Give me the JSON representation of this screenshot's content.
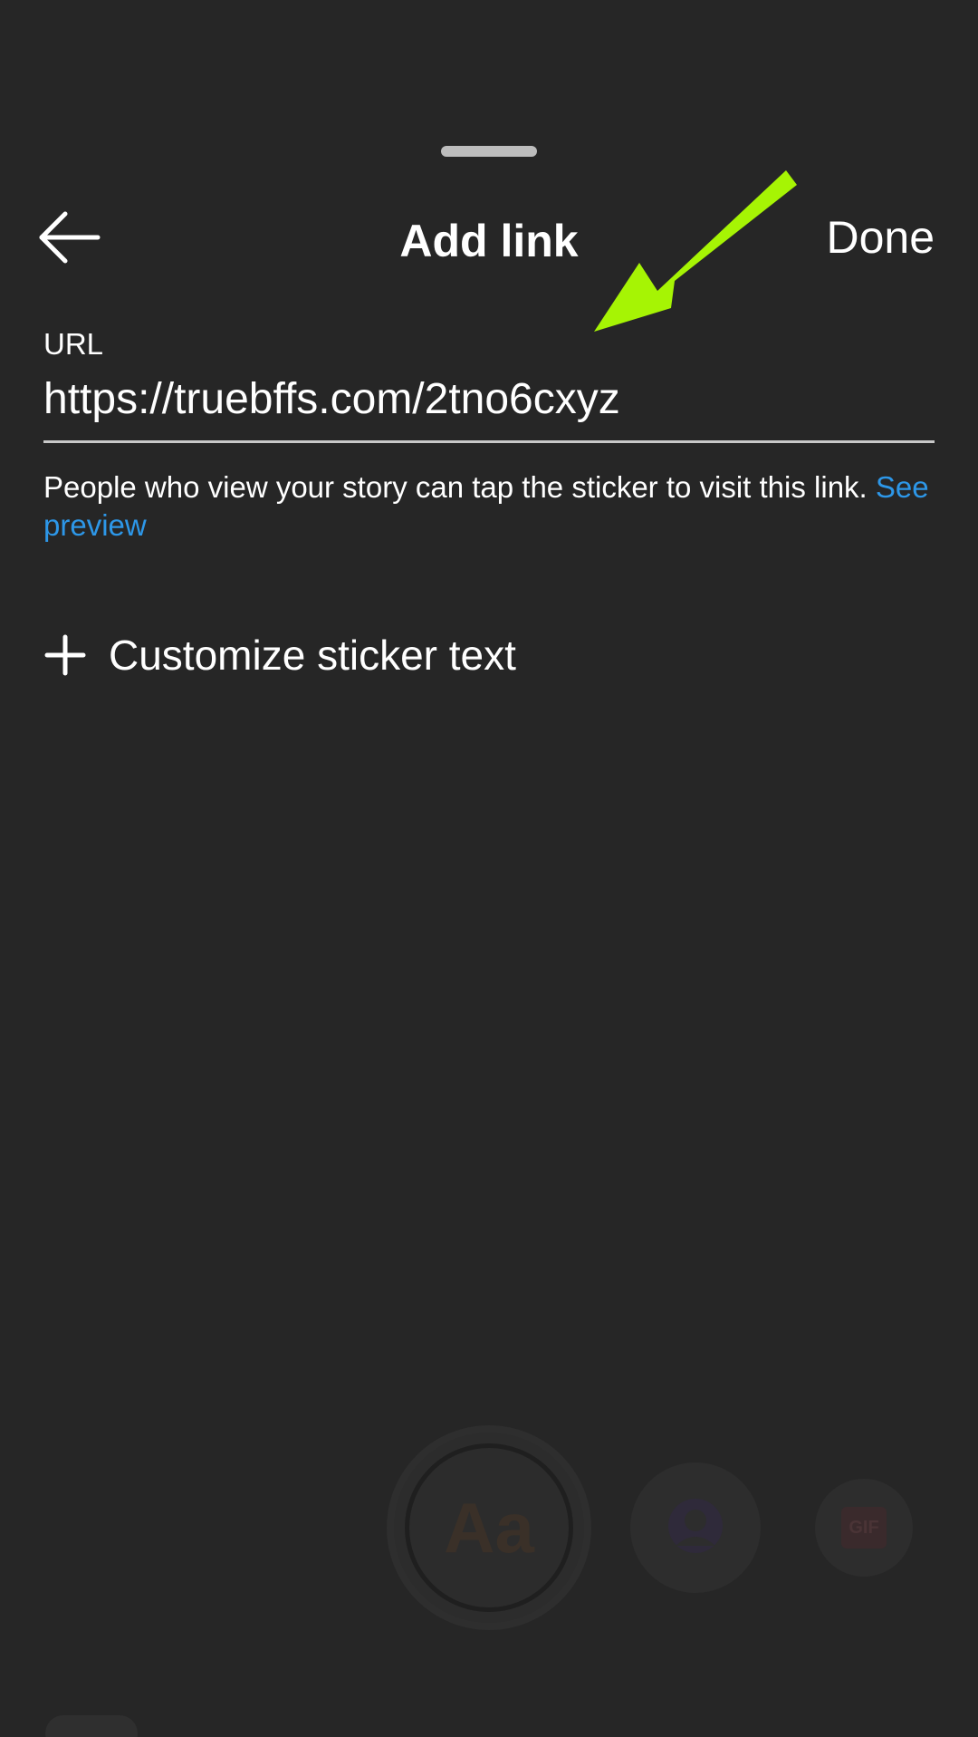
{
  "header": {
    "title": "Add link",
    "done_label": "Done"
  },
  "url_field": {
    "label": "URL",
    "value": "https://truebffs.com/2tno6cxyz"
  },
  "helper": {
    "text": "People who view your story can tap the sticker to visit this link.",
    "link_label": "See preview"
  },
  "customize": {
    "label": "Customize sticker text"
  },
  "background_tools": {
    "text_tool_label": "Aa",
    "gif_label": "GIF"
  },
  "colors": {
    "background": "#262626",
    "text": "#ffffff",
    "link": "#2d97e8",
    "annotation_arrow": "#a6f404"
  },
  "icons": {
    "back": "arrow-left-icon",
    "plus": "plus-icon",
    "annotation": "pointer-arrow-icon"
  }
}
